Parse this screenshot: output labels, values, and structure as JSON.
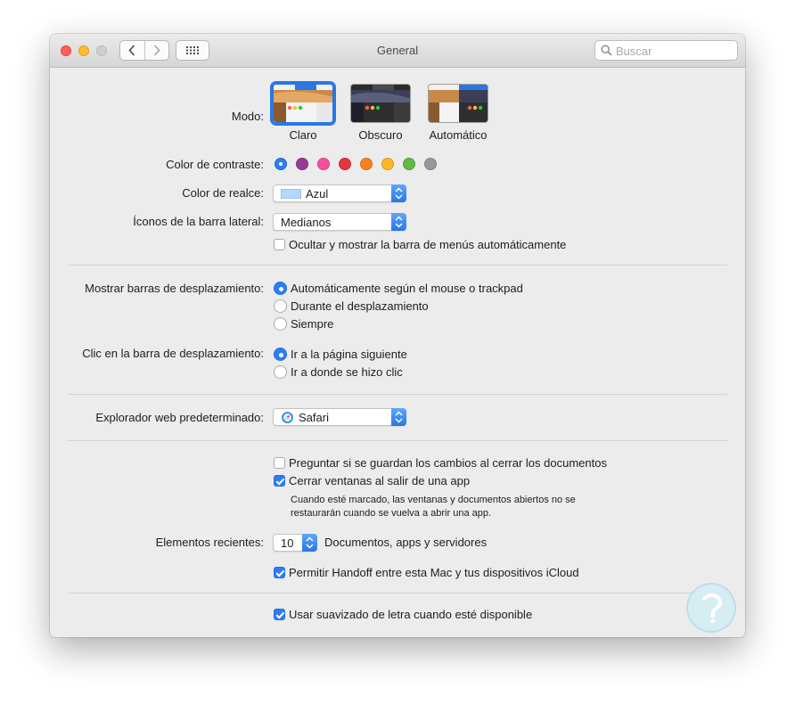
{
  "window": {
    "title": "General"
  },
  "search": {
    "placeholder": "Buscar"
  },
  "appearance": {
    "label": "Modo:",
    "options": [
      {
        "label": "Claro",
        "selected": true
      },
      {
        "label": "Obscuro",
        "selected": false
      },
      {
        "label": "Automático",
        "selected": false
      }
    ]
  },
  "accent": {
    "label": "Color de contraste:",
    "colors": [
      "#2d7df6",
      "#953d96",
      "#f74f9e",
      "#e0383e",
      "#f7821b",
      "#fcb827",
      "#62ba46",
      "#989898"
    ],
    "selected_index": 0
  },
  "highlight": {
    "label": "Color de realce:",
    "value": "Azul",
    "swatch_color": "#b3d7ff"
  },
  "sidebar_icons": {
    "label": "Íconos de la barra lateral:",
    "value": "Medianos"
  },
  "menubar_autohide": {
    "label": "Ocultar y mostrar la barra de menús automáticamente",
    "checked": false
  },
  "show_scrollbars": {
    "label": "Mostrar barras de desplazamiento:",
    "options": [
      {
        "label": "Automáticamente según el mouse o trackpad",
        "selected": true
      },
      {
        "label": "Durante el desplazamiento",
        "selected": false
      },
      {
        "label": "Siempre",
        "selected": false
      }
    ]
  },
  "click_scrollbar": {
    "label": "Clic en la barra de desplazamiento:",
    "options": [
      {
        "label": "Ir a la página siguiente",
        "selected": true
      },
      {
        "label": "Ir a donde se hizo clic",
        "selected": false
      }
    ]
  },
  "default_browser": {
    "label": "Explorador web predeterminado:",
    "value": "Safari"
  },
  "ask_save": {
    "label": "Preguntar si se guardan los cambios al cerrar los documentos",
    "checked": false
  },
  "close_windows": {
    "label": "Cerrar ventanas al salir de una app",
    "checked": true,
    "note_line1": "Cuando esté marcado, las ventanas y documentos abiertos no se",
    "note_line2": "restaurarán cuando se vuelva a abrir una app."
  },
  "recent_items": {
    "label": "Elementos recientes:",
    "value": "10",
    "suffix": "Documentos, apps y servidores"
  },
  "handoff": {
    "label": "Permitir Handoff entre esta Mac y tus dispositivos iCloud",
    "checked": true
  },
  "font_smoothing": {
    "label": "Usar suavizado de letra cuando esté disponible",
    "checked": true
  }
}
